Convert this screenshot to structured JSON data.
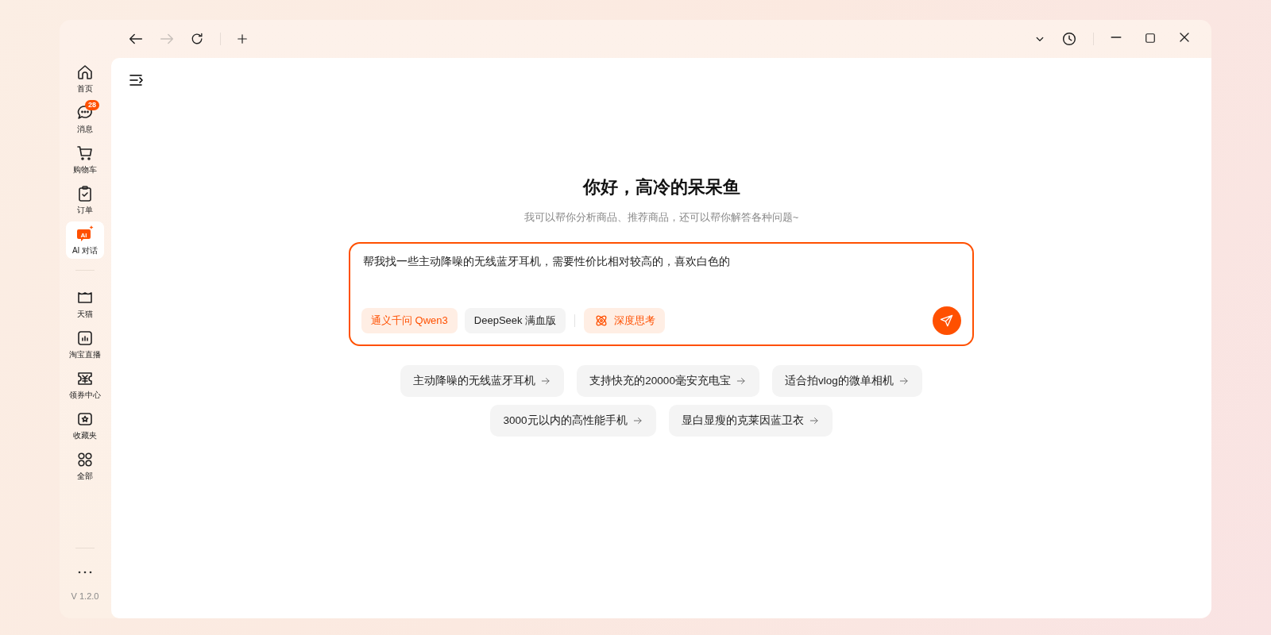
{
  "toolbar": {
    "back": {
      "disabled": false
    },
    "forward": {
      "disabled": true
    }
  },
  "sidebar": {
    "primary_items": [
      {
        "label": "首页",
        "selected": false
      },
      {
        "label": "消息",
        "selected": false,
        "badge": "28"
      },
      {
        "label": "购物车",
        "selected": false
      },
      {
        "label": "订单",
        "selected": false
      },
      {
        "label": "AI 对话",
        "selected": true,
        "icon_text": "AI"
      }
    ],
    "secondary_items": [
      {
        "label": "天猫",
        "selected": false
      },
      {
        "label": "淘宝直播",
        "selected": false
      },
      {
        "label": "领券中心",
        "selected": false
      },
      {
        "label": "收藏夹",
        "selected": false
      },
      {
        "label": "全部",
        "selected": false
      }
    ],
    "version": "V 1.2.0"
  },
  "chat": {
    "greeting": "你好，高冷的呆呆鱼",
    "subtitle": "我可以帮你分析商品、推荐商品，还可以帮你解答各种问题~",
    "input": {
      "value": "帮我找一些主动降噪的无线蓝牙耳机，需要性价比相对较高的，喜欢白色的"
    },
    "models": [
      {
        "label": "通义千问 Qwen3",
        "selected": true
      },
      {
        "label": "DeepSeek 满血版",
        "selected": false
      }
    ],
    "deep_think": {
      "label": "深度思考",
      "on": true
    },
    "suggestions": [
      [
        "主动降噪的无线蓝牙耳机",
        "支持快充的20000毫安充电宝",
        "适合拍vlog的微单相机"
      ],
      [
        "3000元以内的高性能手机",
        "显白显瘦的克莱因蓝卫衣"
      ]
    ]
  }
}
